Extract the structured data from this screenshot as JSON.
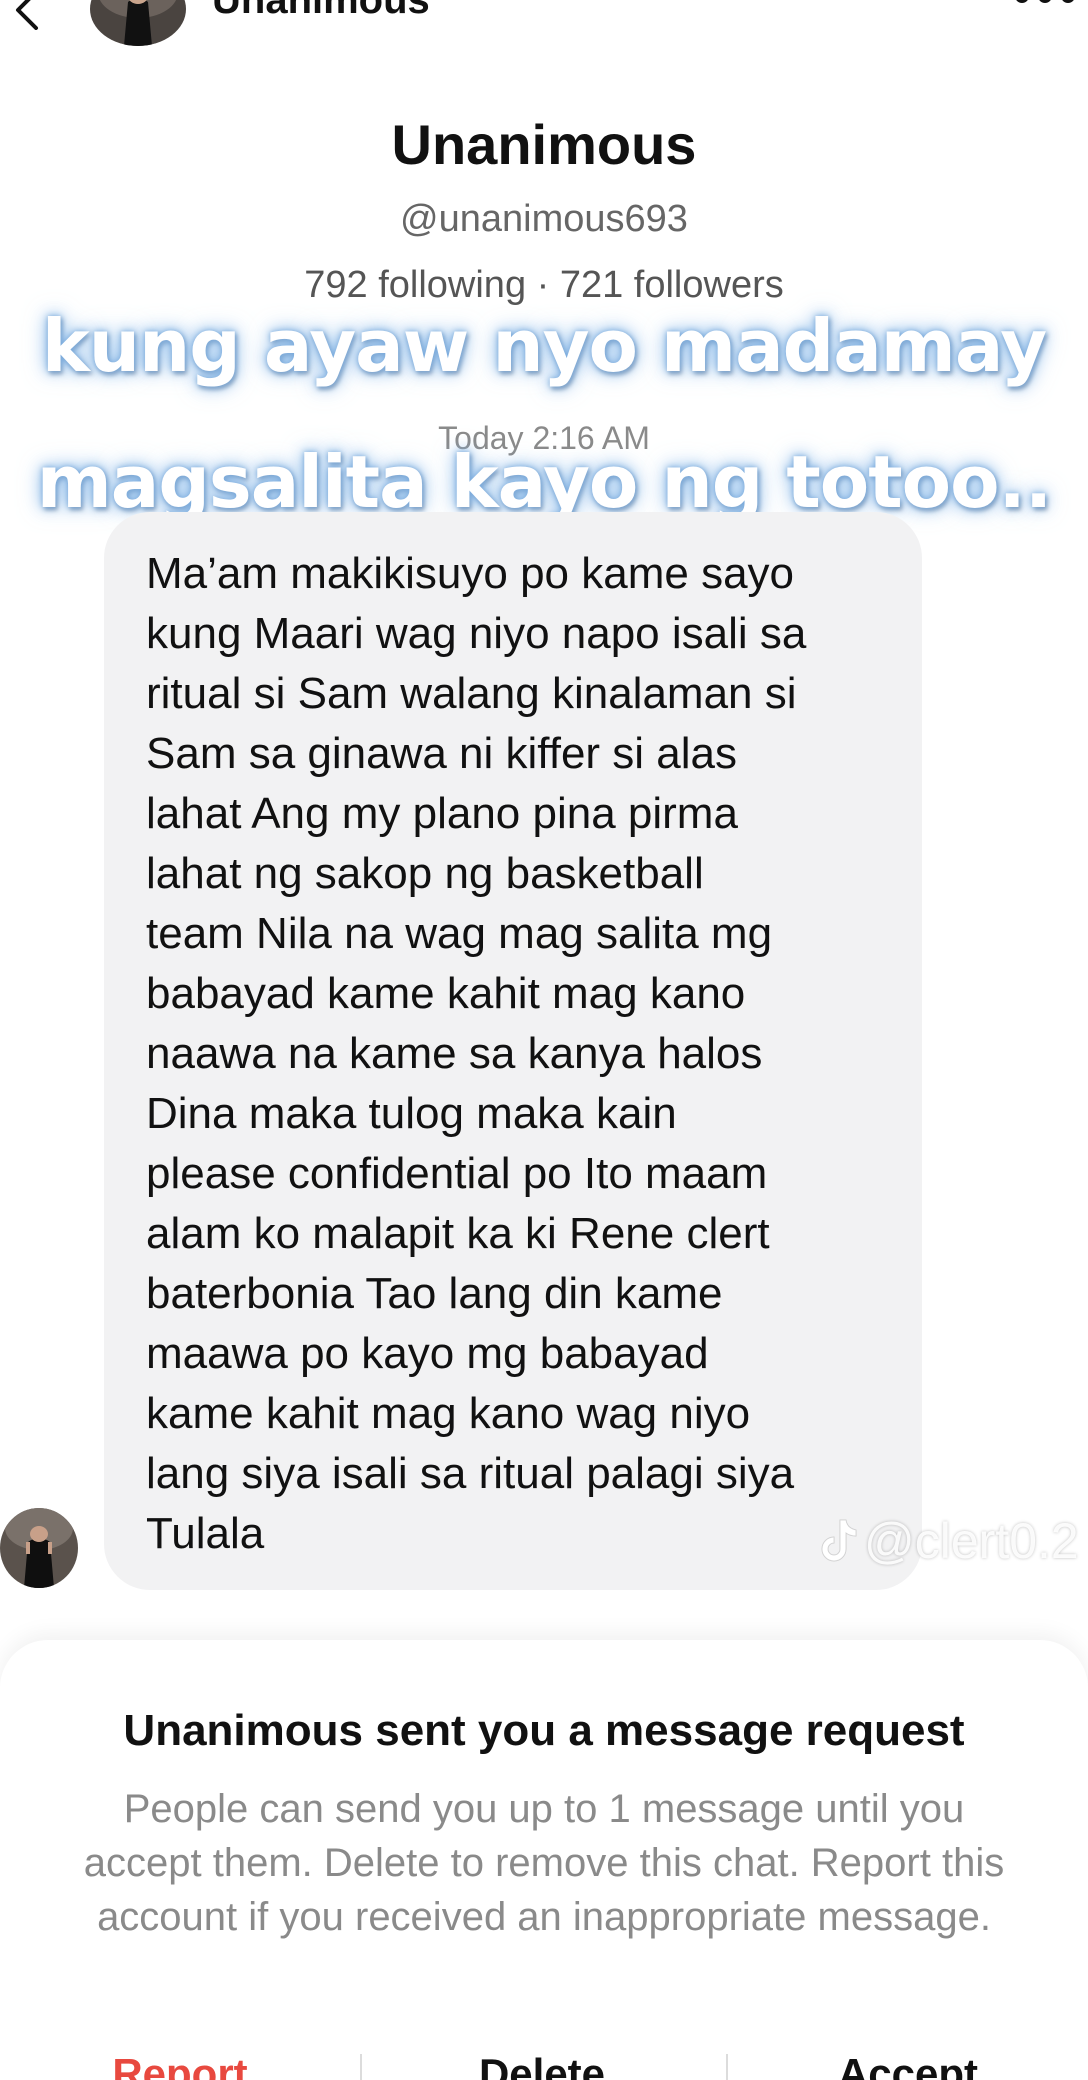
{
  "header": {
    "title": "Unanimous"
  },
  "profile": {
    "name": "Unanimous",
    "handle": "@unanimous693",
    "stats": "792 following · 721 followers"
  },
  "overlay_caption": {
    "line1": "kung ayaw nyo madamay",
    "line2": "magsalita kayo ng totoo.."
  },
  "conversation": {
    "timestamp": "Today 2:16 AM",
    "message_text": "Ma’am makikisuyo po kame sayo\nkung Maari wag niyo napo isali sa\nritual si Sam walang kinalaman si\nSam sa ginawa ni kiffer si alas\nlahat Ang my plano pina pirma\nlahat ng sakop  ng basketball\nteam Nila na wag mag salita mg\nbabayad kame kahit mag kano\nnaawa na kame sa kanya halos\nDina maka tulog maka kain\nplease confidential po Ito maam\nalam ko malapit ka ki Rene clert\nbaterbonia Tao lang din kame\nmaawa po kayo mg babayad\nkame kahit mag kano wag niyo\nlang siya isali sa ritual palagi siya\nTulala"
  },
  "watermark": {
    "text": "@clert0.2"
  },
  "request_sheet": {
    "title": "Unanimous sent you a message request",
    "description": "People can send you up to 1 message until you accept them. Delete to remove this chat. Report this account if you received an inappropriate message.",
    "report_label": "Report",
    "delete_label": "Delete",
    "accept_label": "Accept"
  },
  "colors": {
    "bubble_background": "#f2f2f3",
    "report_red": "#e8493f",
    "secondary_text": "#8a8a8a"
  },
  "icons": {
    "back": "back-chevron-icon",
    "more": "more-dots-icon",
    "watermark": "tiktok-icon"
  }
}
